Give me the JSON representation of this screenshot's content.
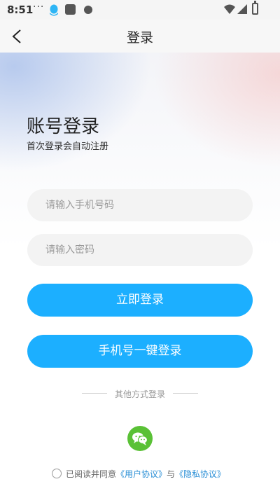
{
  "status_bar": {
    "time": "8:51",
    "overflow_indicator": "···",
    "icons": [
      "qq-icon",
      "app-icon",
      "notification-icon",
      "wifi-icon",
      "signal-icon",
      "battery-icon"
    ]
  },
  "nav": {
    "back_icon": "chevron-left-icon",
    "title": "登录"
  },
  "login": {
    "heading": "账号登录",
    "subheading": "首次登录会自动注册",
    "phone_placeholder": "请输入手机号码",
    "password_placeholder": "请输入密码",
    "login_button": "立即登录",
    "one_click_button": "手机号一键登录",
    "other_methods_label": "其他方式登录",
    "social_icon": "wechat-icon"
  },
  "agreement": {
    "prefix": "已阅读并同意",
    "user_agreement": "《用户协议》",
    "conjunction": "与",
    "privacy_policy": "《隐私协议》"
  },
  "colors": {
    "primary": "#1cafff",
    "wechat": "#5ac136",
    "link": "#2a8fd6"
  }
}
